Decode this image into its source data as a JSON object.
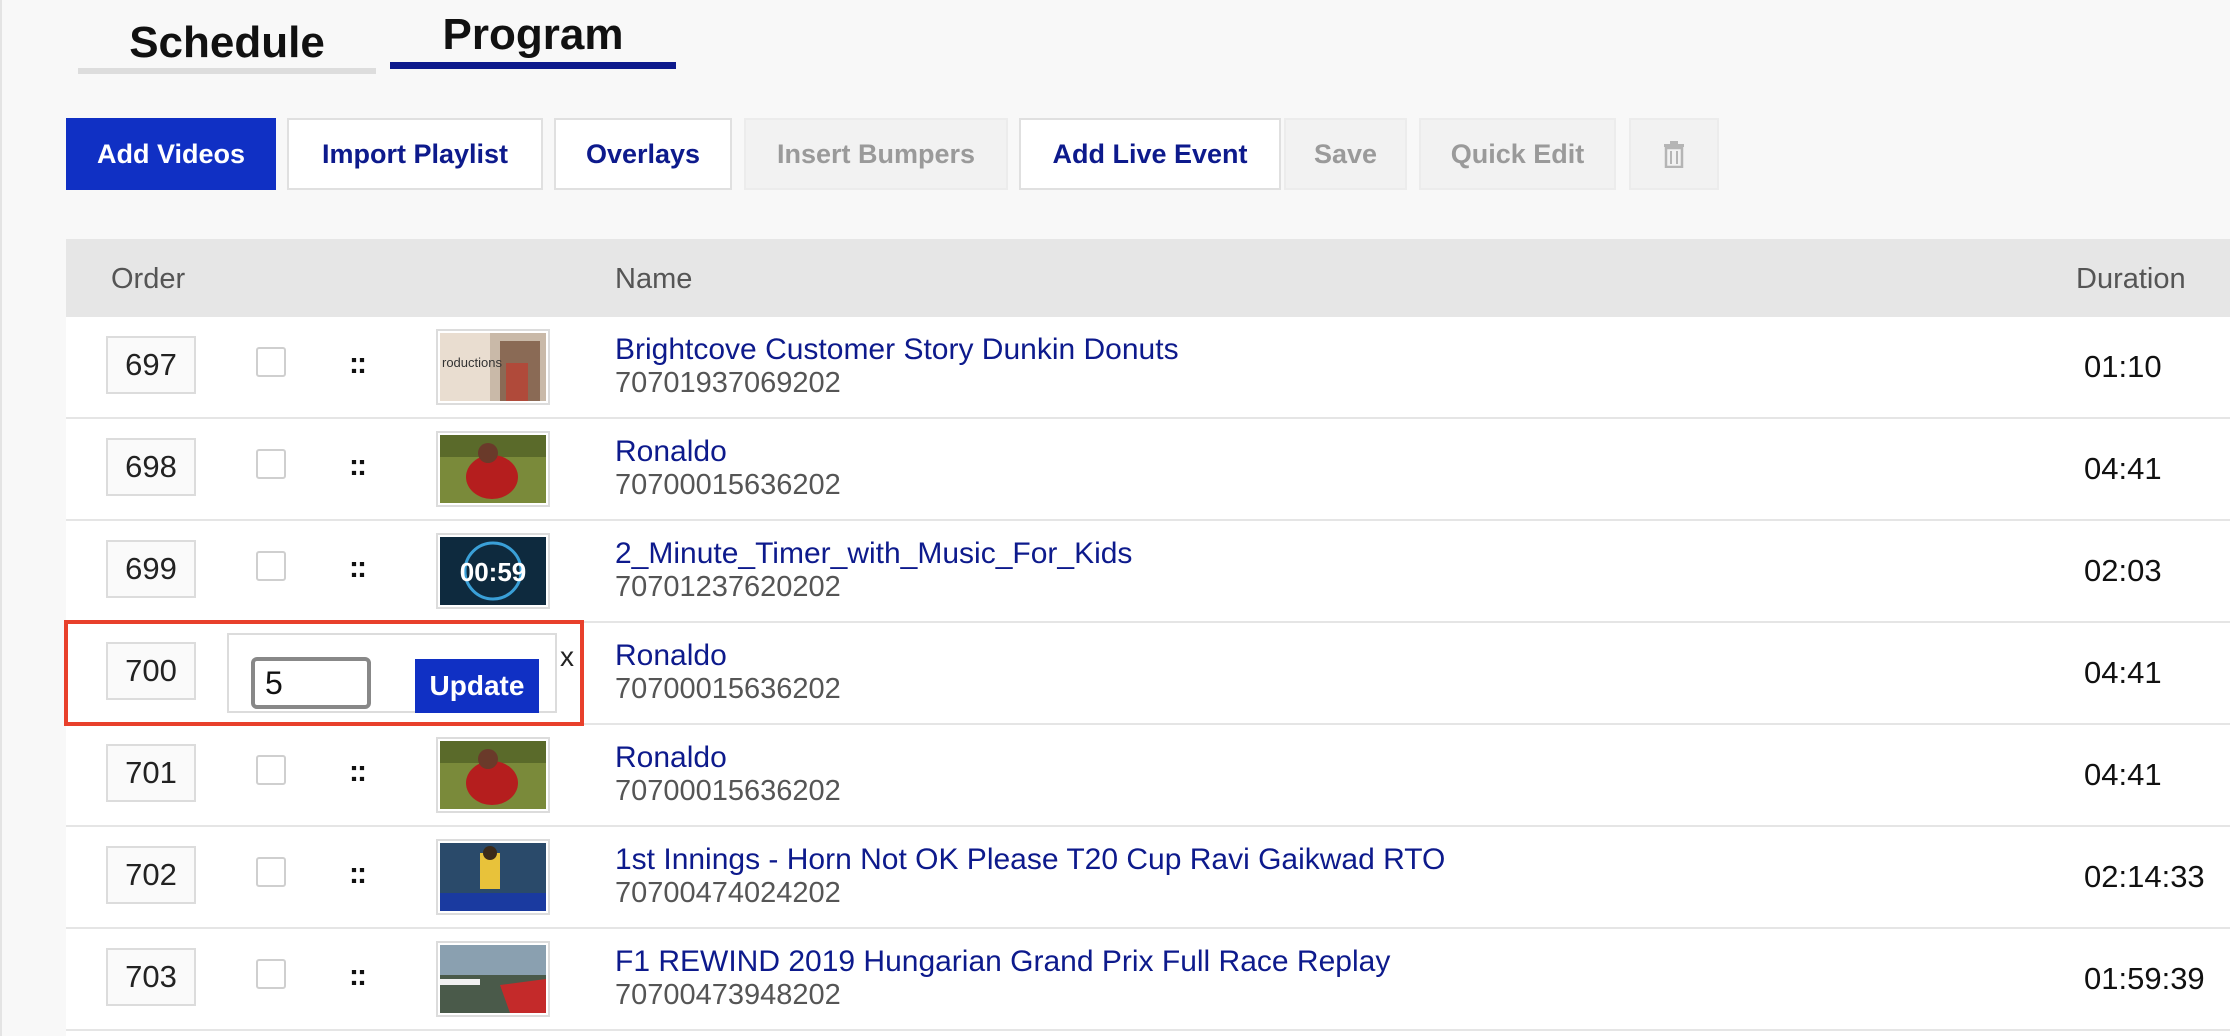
{
  "tabs": {
    "schedule": "Schedule",
    "program": "Program"
  },
  "toolbar": {
    "add_videos": "Add Videos",
    "import_playlist": "Import Playlist",
    "overlays": "Overlays",
    "insert_bumpers": "Insert Bumpers",
    "add_live_event": "Add Live Event",
    "save": "Save",
    "quick_edit": "Quick Edit",
    "delete_icon": "trash-icon"
  },
  "table": {
    "headers": {
      "order": "Order",
      "name": "Name",
      "duration": "Duration"
    },
    "rows": [
      {
        "order": "697",
        "name": "Brightcove Customer Story Dunkin Donuts",
        "id": "70701937069202",
        "duration": "01:10",
        "thumb": "productions-icon"
      },
      {
        "order": "698",
        "name": "Ronaldo",
        "id": "70700015636202",
        "duration": "04:41",
        "thumb": "soccer-player-icon"
      },
      {
        "order": "699",
        "name": "2_Minute_Timer_with_Music_For_Kids",
        "id": "70701237620202",
        "duration": "02:03",
        "thumb": "timer-icon",
        "thumb_text": "00:59"
      },
      {
        "order": "700",
        "name": "Ronaldo",
        "id": "70700015636202",
        "duration": "04:41",
        "editing": true
      },
      {
        "order": "701",
        "name": "Ronaldo",
        "id": "70700015636202",
        "duration": "04:41",
        "thumb": "soccer-player-icon"
      },
      {
        "order": "702",
        "name": "1st Innings - Horn Not OK Please T20 Cup Ravi Gaikwad RTO",
        "id": "70700474024202",
        "duration": "02:14:33",
        "thumb": "cricket-icon"
      },
      {
        "order": "703",
        "name": "F1 REWIND 2019 Hungarian Grand Prix Full Race Replay",
        "id": "70700473948202",
        "duration": "01:59:39",
        "thumb": "f1-car-icon"
      }
    ]
  },
  "editor": {
    "value": "5",
    "update_label": "Update",
    "close_label": "x"
  },
  "colors": {
    "accent": "#1030c4",
    "link": "#0d1a8c",
    "highlight": "#e8402b"
  }
}
